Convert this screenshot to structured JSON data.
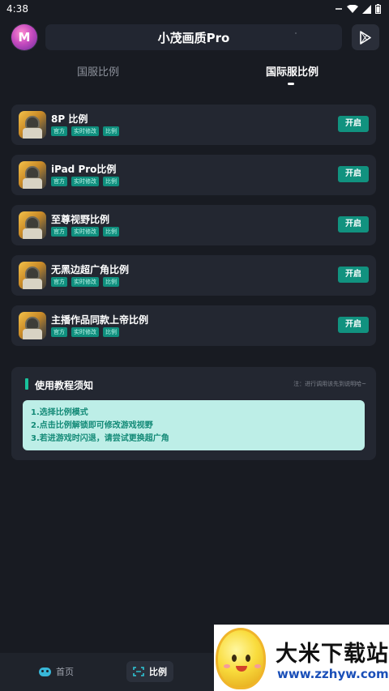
{
  "status_bar": {
    "time": "4:38"
  },
  "header": {
    "title": "小茂画质Pro",
    "logo_text": "M"
  },
  "tabs": [
    {
      "label": "国服比例",
      "active": false
    },
    {
      "label": "国际服比例",
      "active": true
    }
  ],
  "items": [
    {
      "title": "8P 比例",
      "tags": [
        "官方",
        "实时修改",
        "比例"
      ],
      "button": "开启"
    },
    {
      "title": "iPad Pro比例",
      "tags": [
        "官方",
        "实时修改",
        "比例"
      ],
      "button": "开启"
    },
    {
      "title": "至尊视野比例",
      "tags": [
        "官方",
        "实时修改",
        "比例"
      ],
      "button": "开启"
    },
    {
      "title": "无黑边超广角比例",
      "tags": [
        "官方",
        "实时修改",
        "比例"
      ],
      "button": "开启"
    },
    {
      "title": "主播作品同款上帝比例",
      "tags": [
        "官方",
        "实时修改",
        "比例"
      ],
      "button": "开启"
    }
  ],
  "guide": {
    "title": "使用教程须知",
    "note": "注：进行调用该先到说明哈~",
    "lines": [
      "1.选择比例模式",
      "2.点击比例解锁即可修改游戏视野",
      "3.若进游戏时闪退，请尝试更换超广角"
    ]
  },
  "bottom_nav": {
    "home": "首页",
    "ratio": "比例"
  },
  "watermark": {
    "title": "大米下载站",
    "url": "www.zzhyw.com"
  },
  "colors": {
    "accent": "#11927f",
    "background": "#181b22",
    "card": "#232731"
  }
}
